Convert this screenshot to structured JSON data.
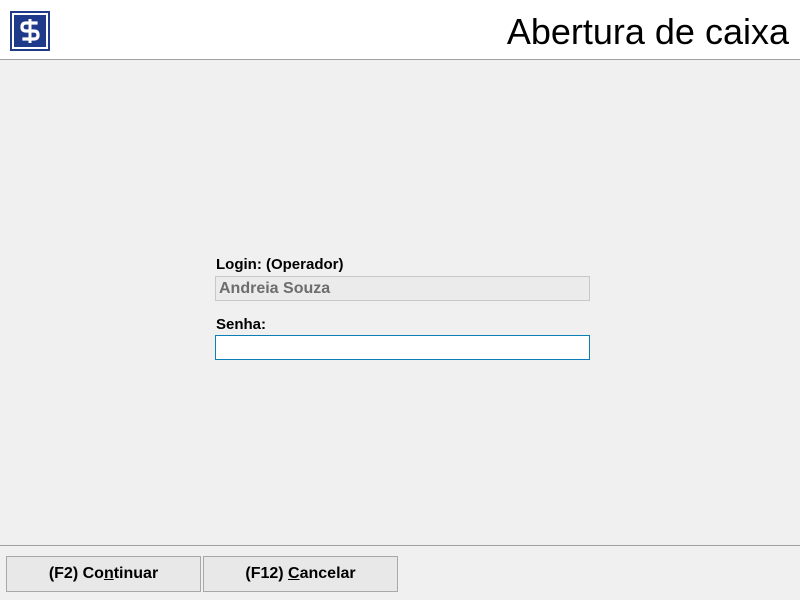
{
  "header": {
    "title": "Abertura de caixa",
    "logo_icon": "dollar-sign-icon",
    "logo_color": "#1f3a8a"
  },
  "form": {
    "login": {
      "label": "Login: (Operador)",
      "value": "Andreia Souza"
    },
    "senha": {
      "label": "Senha:",
      "value": ""
    }
  },
  "footer": {
    "continue_button": {
      "prefix": "(F2) Co",
      "mnemonic": "n",
      "suffix": "tinuar"
    },
    "cancel_button": {
      "prefix": "(F12) ",
      "mnemonic": "C",
      "suffix": "ancelar"
    }
  },
  "colors": {
    "focus_border": "#0b7fb5",
    "background": "#f0f0f0"
  }
}
